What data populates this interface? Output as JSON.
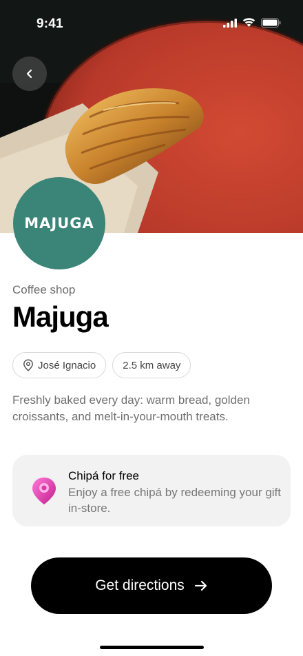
{
  "status_bar": {
    "time": "9:41"
  },
  "shop": {
    "logo_text": "MAJUGA",
    "category": "Coffee shop",
    "name": "Majuga",
    "location": "José Ignacio",
    "distance": "2.5 km away",
    "description": "Freshly baked every day: warm bread, golden croissants, and melt-in-your-mouth treats."
  },
  "promo": {
    "title": "Chipá for free",
    "text": "Enjoy a free chipá by redeeming your gift in-store."
  },
  "cta": {
    "label": "Get directions"
  },
  "colors": {
    "logo_bg": "#3b8478",
    "cta_bg": "#000000",
    "promo_bg": "#f2f2f2",
    "plate_red": "#c2402c"
  }
}
